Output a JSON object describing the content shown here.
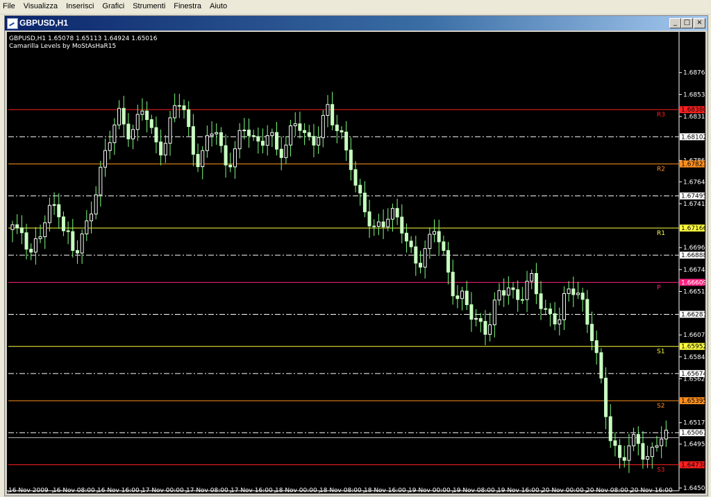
{
  "menu": {
    "items": [
      "File",
      "Visualizza",
      "Inserisci",
      "Grafici",
      "Strumenti",
      "Finestra",
      "Aiuto"
    ]
  },
  "window": {
    "title": "GBPUSD,H1",
    "controls": {
      "minimize": "_",
      "maximize": "□",
      "close": "×"
    }
  },
  "chart": {
    "info_line": "GBPUSD,H1  1.65078 1.65113 1.64924 1.65016",
    "indicator_name": "Camarilla Levels by MoStAsHaR15",
    "colors": {
      "background": "#000000",
      "candle_bull": "#ffffff",
      "candle_bear": "#c8ffc0",
      "wick": "#7fff7f",
      "axis_text": "#ffffff",
      "dashed_line": "#ffffff"
    }
  },
  "chart_data": {
    "type": "candlestick",
    "symbol": "GBPUSD",
    "timeframe": "H1",
    "ylim": [
      1.645,
      1.6895
    ],
    "y_ticks": [
      {
        "value": 1.6876,
        "label": "1.68760"
      },
      {
        "value": 1.68535,
        "label": "1.68535"
      },
      {
        "value": 1.6831,
        "label": "1.68310"
      },
      {
        "value": 1.6786,
        "label": "1.67860"
      },
      {
        "value": 1.6764,
        "label": "1.67640"
      },
      {
        "value": 1.67415,
        "label": "1.67415"
      },
      {
        "value": 1.66965,
        "label": "1.66965"
      },
      {
        "value": 1.6674,
        "label": "1.66740"
      },
      {
        "value": 1.66515,
        "label": "1.66515"
      },
      {
        "value": 1.6607,
        "label": "1.66070"
      },
      {
        "value": 1.65845,
        "label": "1.65845"
      },
      {
        "value": 1.6562,
        "label": "1.65620"
      },
      {
        "value": 1.6517,
        "label": "1.65170"
      },
      {
        "value": 1.6495,
        "label": "1.64950"
      },
      {
        "value": 1.645,
        "label": "1.64500"
      }
    ],
    "x_labels": [
      "16 Nov 2009",
      "16 Nov 08:00",
      "16 Nov 16:00",
      "17 Nov 00:00",
      "17 Nov 08:00",
      "17 Nov 16:00",
      "18 Nov 00:00",
      "18 Nov 08:00",
      "18 Nov 16:00",
      "19 Nov 00:00",
      "19 Nov 08:00",
      "19 Nov 16:00",
      "20 Nov 00:00",
      "20 Nov 08:00",
      "20 Nov 16:00"
    ],
    "levels": [
      {
        "name": "R3",
        "value": 1.6838,
        "label": "1.68380",
        "color": "#ff2020",
        "badge_bg": "#ff2020",
        "badge_fg": "#000000"
      },
      {
        "name": "R2",
        "value": 1.67823,
        "label": "1.67823",
        "color": "#ff9020",
        "badge_bg": "#ff9020",
        "badge_fg": "#000000"
      },
      {
        "name": "R1",
        "value": 1.67166,
        "label": "1.67166",
        "color": "#ffff40",
        "badge_bg": "#ffff40",
        "badge_fg": "#000000"
      },
      {
        "name": "P",
        "value": 1.66609,
        "label": "1.66609",
        "color": "#ff2080",
        "badge_bg": "#ff2080",
        "badge_fg": "#ffffff"
      },
      {
        "name": "S1",
        "value": 1.65952,
        "label": "1.65952",
        "color": "#ffff40",
        "badge_bg": "#ffff40",
        "badge_fg": "#000000"
      },
      {
        "name": "S2",
        "value": 1.65395,
        "label": "1.65395",
        "color": "#ff9020",
        "badge_bg": "#ff9020",
        "badge_fg": "#000000"
      },
      {
        "name": "S3",
        "value": 1.64738,
        "label": "1.64738",
        "color": "#ff2020",
        "badge_bg": "#ff2020",
        "badge_fg": "#000000"
      }
    ],
    "dashed_levels": [
      {
        "value": 1.68102,
        "label": "1.68102"
      },
      {
        "value": 1.67495,
        "label": "1.67495"
      },
      {
        "value": 1.66888,
        "label": "1.66888"
      },
      {
        "value": 1.66281,
        "label": "1.66281"
      },
      {
        "value": 1.65674,
        "label": "1.65674"
      },
      {
        "value": 1.65067,
        "label": "1.65067"
      }
    ],
    "current_price": 1.65016,
    "anchors": [
      1.6715,
      1.6705,
      1.672,
      1.669,
      1.67,
      1.671,
      1.6725,
      1.6735,
      1.6745,
      1.672,
      1.6705,
      1.6685,
      1.67,
      1.6715,
      1.674,
      1.6765,
      1.678,
      1.68,
      1.682,
      1.6835,
      1.6825,
      1.6815,
      1.682,
      1.6835,
      1.683,
      1.681,
      1.68,
      1.6805,
      1.682,
      1.684,
      1.685,
      1.6825,
      1.68,
      1.6785,
      1.679,
      1.681,
      1.6825,
      1.68,
      1.678,
      1.679,
      1.68,
      1.6815,
      1.682,
      1.681,
      1.68,
      1.6815,
      1.6805,
      1.679,
      1.68,
      1.6815,
      1.6825,
      1.682,
      1.6805,
      1.68,
      1.6815,
      1.683,
      1.684,
      1.682,
      1.681,
      1.68,
      1.679,
      1.676,
      1.674,
      1.6725,
      1.671,
      1.672,
      1.673,
      1.6735,
      1.6725,
      1.6715,
      1.67,
      1.669,
      1.6685,
      1.669,
      1.67,
      1.6715,
      1.67,
      1.668,
      1.666,
      1.6645,
      1.664,
      1.663,
      1.6625,
      1.662,
      1.6615,
      1.6625,
      1.664,
      1.665,
      1.666,
      1.665,
      1.6645,
      1.6655,
      1.666,
      1.665,
      1.664,
      1.663,
      1.6625,
      1.662,
      1.664,
      1.6655,
      1.666,
      1.6645,
      1.662,
      1.66,
      1.657,
      1.654,
      1.651,
      1.649,
      1.6475,
      1.6485,
      1.6495,
      1.65,
      1.649,
      1.648,
      1.649,
      1.65,
      1.6502
    ]
  }
}
